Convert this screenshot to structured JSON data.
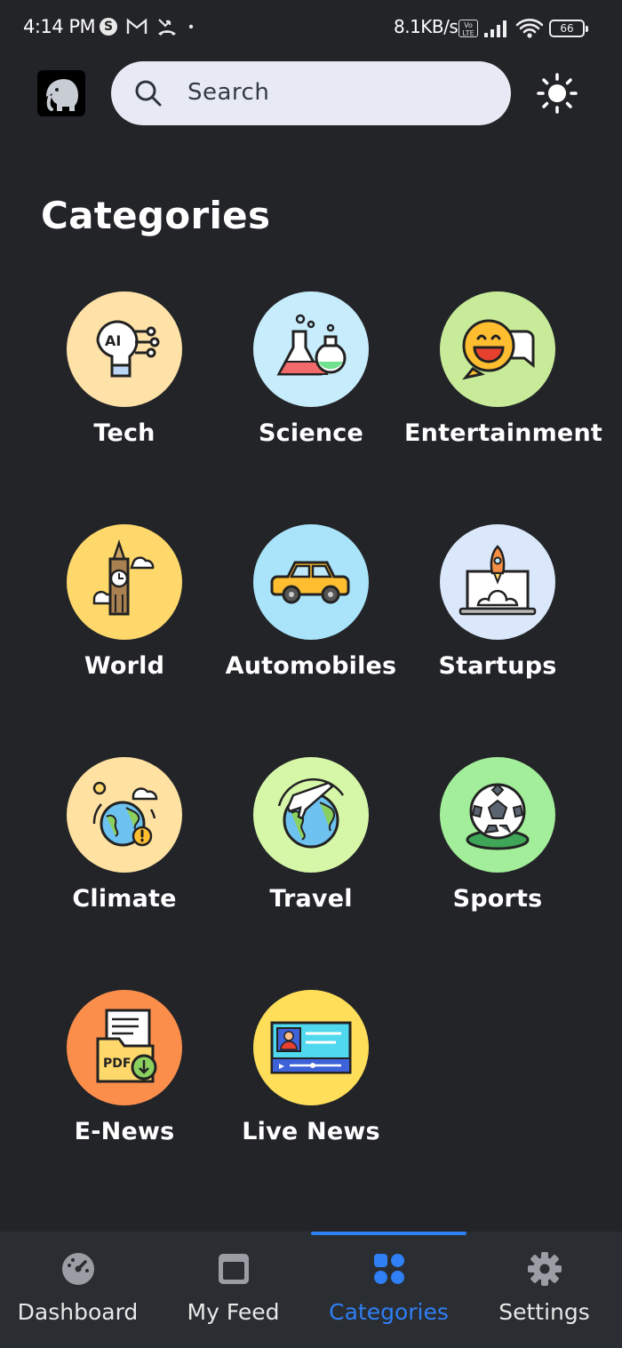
{
  "status_bar": {
    "time": "4:14 PM",
    "network_speed": "8.1KB/s",
    "battery": "66",
    "volte": "Vo LTE"
  },
  "header": {
    "search_placeholder": "Search"
  },
  "page_title": "Categories",
  "categories": [
    {
      "label": "Tech",
      "icon": "ai-brain-icon",
      "color": "#ffe2a8"
    },
    {
      "label": "Science",
      "icon": "lab-flask-icon",
      "color": "#c7ecfb"
    },
    {
      "label": "Entertainment",
      "icon": "laughing-chat-icon",
      "color": "#c8eb99"
    },
    {
      "label": "World",
      "icon": "big-ben-icon",
      "color": "#ffd86b"
    },
    {
      "label": "Automobiles",
      "icon": "car-icon",
      "color": "#a9e4fb"
    },
    {
      "label": "Startups",
      "icon": "rocket-laptop-icon",
      "color": "#dbe8fb"
    },
    {
      "label": "Climate",
      "icon": "globe-weather-icon",
      "color": "#ffe2a2"
    },
    {
      "label": "Travel",
      "icon": "globe-plane-icon",
      "color": "#d6f7a8"
    },
    {
      "label": "Sports",
      "icon": "soccer-ball-icon",
      "color": "#a3ee9a"
    },
    {
      "label": "E-News",
      "icon": "pdf-download-icon",
      "color": "#fc8e4c"
    },
    {
      "label": "Live News",
      "icon": "live-video-icon",
      "color": "#ffde59"
    }
  ],
  "bottom_nav": [
    {
      "label": "Dashboard",
      "icon": "speedometer-icon",
      "active": false
    },
    {
      "label": "My Feed",
      "icon": "feed-window-icon",
      "active": false
    },
    {
      "label": "Categories",
      "icon": "grid-icon",
      "active": true
    },
    {
      "label": "Settings",
      "icon": "gear-icon",
      "active": false
    }
  ],
  "colors": {
    "background": "#222428",
    "accent": "#2f7ff5",
    "search_bg": "#e7eaf4"
  }
}
